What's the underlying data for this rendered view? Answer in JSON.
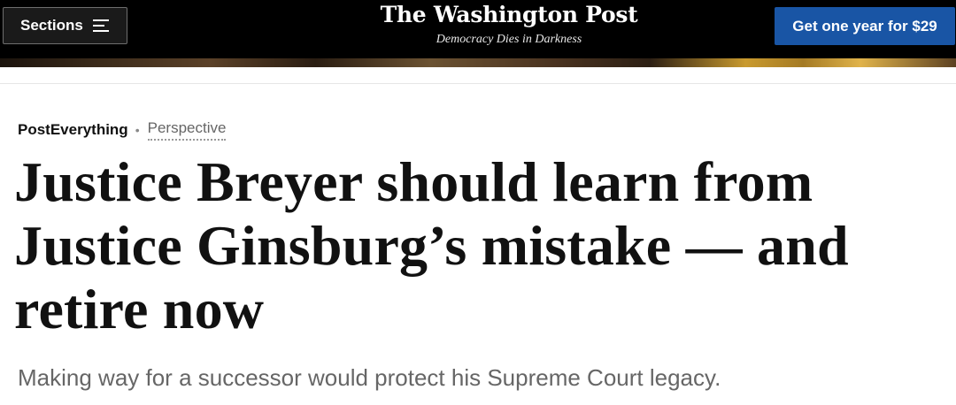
{
  "header": {
    "sections_label": "Sections",
    "sections_icon": "hamburger-menu-icon",
    "logo_text": "The Washington Post",
    "tagline": "Democracy Dies in Darkness",
    "subscribe_label": "Get one year for $29",
    "subscribe_color": "#1955a5"
  },
  "article": {
    "section": "PostEverything",
    "label": "Perspective",
    "headline": "Justice Breyer should learn from Justice Ginsburg’s mistake — and retire now",
    "dek": "Making way for a successor would protect his Supreme Court legacy."
  }
}
